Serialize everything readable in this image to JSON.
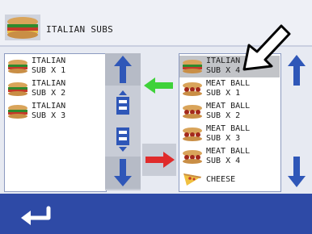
{
  "header": {
    "title": "ITALIAN SUBS",
    "thumb_icon": "sandwich-icon"
  },
  "left_list": {
    "items": [
      {
        "label": "ITALIAN\nSUB X 1",
        "icon": "italian-sub-icon"
      },
      {
        "label": "ITALIAN\nSUB X 2",
        "icon": "italian-sub-icon"
      },
      {
        "label": "ITALIAN\nSUB X 3",
        "icon": "italian-sub-icon"
      }
    ]
  },
  "right_list": {
    "items": [
      {
        "label": "ITALIAN\nSUB X 4",
        "icon": "italian-sub-icon",
        "selected": true
      },
      {
        "label": "MEAT BALL\nSUB X 1",
        "icon": "meatball-sub-icon"
      },
      {
        "label": "MEAT BALL\nSUB X 2",
        "icon": "meatball-sub-icon"
      },
      {
        "label": "MEAT BALL\nSUB X 3",
        "icon": "meatball-sub-icon"
      },
      {
        "label": "MEAT BALL\nSUB X 4",
        "icon": "meatball-sub-icon"
      },
      {
        "label": "CHEESE",
        "icon": "cheese-pizza-icon"
      }
    ]
  },
  "colors": {
    "arrow_blue": "#2f57b8",
    "arrow_green": "#3fd23a",
    "arrow_red": "#e02b2b",
    "footer_blue": "#2e4aa6"
  }
}
